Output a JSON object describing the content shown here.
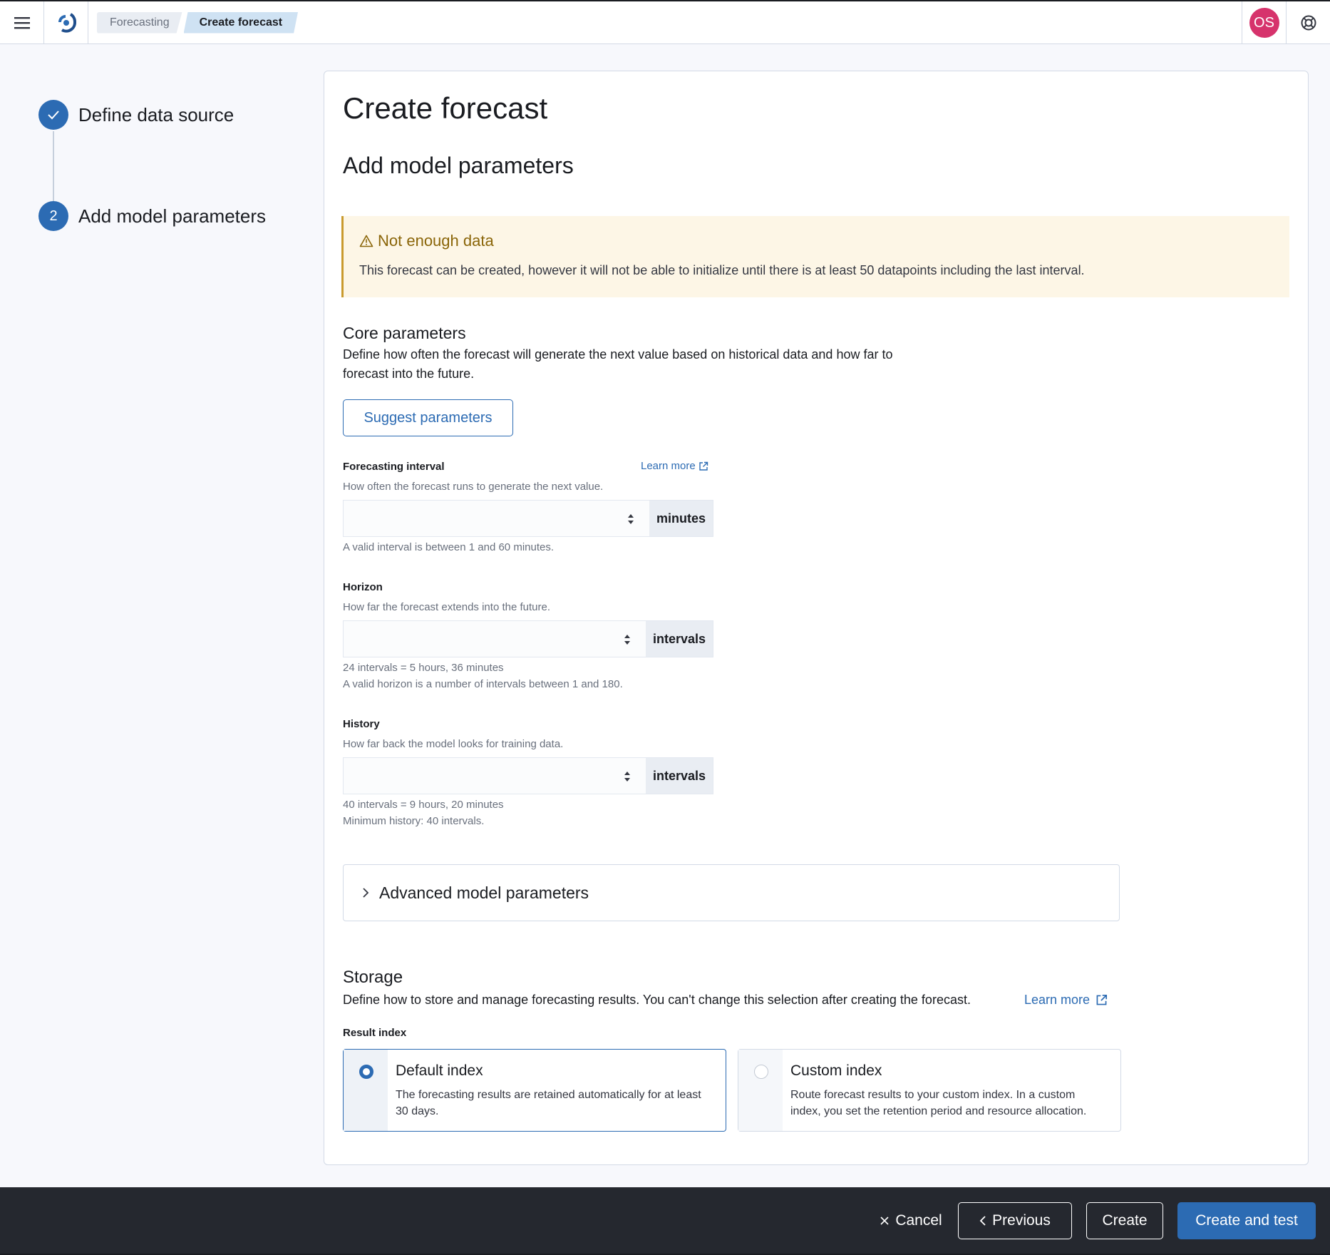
{
  "header": {
    "breadcrumbs": [
      "Forecasting",
      "Create forecast"
    ],
    "avatar_initials": "OS"
  },
  "steps": [
    {
      "label": "Define data source",
      "status": "complete",
      "icon": "check-icon"
    },
    {
      "label": "Add model parameters",
      "status": "current",
      "number": "2"
    }
  ],
  "main": {
    "title": "Create forecast",
    "subtitle": "Add model parameters",
    "callout": {
      "title": "Not enough data",
      "text": "This forecast can be created, however it will not be able to initialize until there is at least 50 datapoints including the last interval.",
      "color": "#fdf6e6"
    },
    "core": {
      "title": "Core parameters",
      "desc_line1": "Define how often the forecast will generate the next value based on historical data and how far to",
      "desc_line2": "forecast into the future.",
      "suggest_label": "Suggest parameters"
    },
    "interval": {
      "label": "Forecasting interval",
      "learn_more": "Learn more",
      "help": "How often the forecast runs to generate the next value.",
      "value": "",
      "unit": "minutes",
      "note": "A valid interval is between 1 and 60 minutes."
    },
    "horizon": {
      "label": "Horizon",
      "help": "How far the forecast extends into the future.",
      "value": "",
      "unit": "intervals",
      "note1": "24 intervals = 5 hours, 36 minutes",
      "note2": "A valid horizon is a number of intervals between 1 and 180."
    },
    "history": {
      "label": "History",
      "help": "How far back the model looks for training data.",
      "value": "",
      "unit": "intervals",
      "note1": "40 intervals = 9 hours, 20 minutes",
      "note2": "Minimum history: 40 intervals."
    },
    "advanced_label": "Advanced model parameters",
    "storage": {
      "title": "Storage",
      "desc": "Define how to store and manage forecasting results. You can't change this selection after creating the forecast.",
      "learn_more": "Learn more",
      "result_index_label": "Result index",
      "options": [
        {
          "title": "Default index",
          "desc": "The forecasting results are retained automatically for at least 30 days.",
          "selected": true
        },
        {
          "title": "Custom index",
          "desc": "Route forecast results to your custom index. In a custom index, you set the retention period and resource allocation.",
          "selected": false
        }
      ]
    }
  },
  "footer": {
    "cancel": "Cancel",
    "previous": "Previous",
    "create": "Create",
    "create_and_test": "Create and test"
  },
  "colors": {
    "accent": "#2c6bb3",
    "warning_text": "#8a6508",
    "avatar": "#d6336c",
    "footer_bg": "#25282f"
  }
}
